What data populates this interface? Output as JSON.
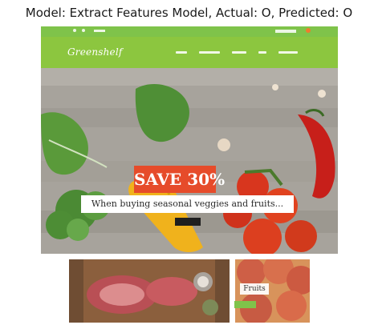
{
  "figure": {
    "title": "Model: Extract Features Model, Actual: O, Predicted: O"
  },
  "site": {
    "brand_color": "#8cc63f",
    "logo_text": "Greenshelf",
    "topbar_icons": [
      "phone-icon",
      "mail-icon",
      "user-icon",
      "cart-icon"
    ],
    "hero": {
      "badge": "SAVE 30%",
      "tagline": "When buying seasonal veggies and fruits...",
      "badge_color": "#e64b2a"
    },
    "promo": {
      "fruits_label": "Fruits"
    }
  }
}
